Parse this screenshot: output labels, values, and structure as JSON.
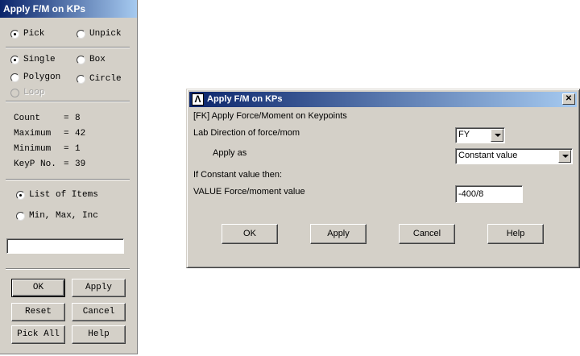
{
  "picker": {
    "title": "Apply F/M on KPs",
    "mode_options": [
      {
        "label": "Pick",
        "checked": true
      },
      {
        "label": "Unpick",
        "checked": false
      }
    ],
    "shape_options": [
      {
        "label": "Single",
        "checked": true
      },
      {
        "label": "Box",
        "checked": false
      },
      {
        "label": "Polygon",
        "checked": false
      },
      {
        "label": "Circle",
        "checked": false
      },
      {
        "label": "Loop",
        "checked": false,
        "disabled": true
      }
    ],
    "info": [
      {
        "key": "Count",
        "value": "8"
      },
      {
        "key": "Maximum",
        "value": "42"
      },
      {
        "key": "Minimum",
        "value": "1"
      },
      {
        "key": "KeyP No.",
        "value": "39"
      }
    ],
    "list_options": [
      {
        "label": "List of Items",
        "checked": true
      },
      {
        "label": "Min, Max, Inc",
        "checked": false
      }
    ],
    "entry_value": "",
    "buttons": {
      "ok": "OK",
      "apply": "Apply",
      "reset": "Reset",
      "cancel": "Cancel",
      "pick_all": "Pick All",
      "help": "Help"
    }
  },
  "dialog": {
    "title": "Apply F/M on KPs",
    "logo_glyph": "Λ",
    "close_glyph": "✕",
    "command": "[FK]  Apply Force/Moment on Keypoints",
    "lab_label": "Lab    Direction of force/mom",
    "lab_value": "FY",
    "apply_as_label": "Apply as",
    "apply_as_value": "Constant value",
    "if_constant_label": "If Constant value then:",
    "value_label": "VALUE  Force/moment value",
    "value_value": "-400/8",
    "buttons": {
      "ok": "OK",
      "apply": "Apply",
      "cancel": "Cancel",
      "help": "Help"
    }
  },
  "colors": {
    "panel_bg": "#d4d0c8",
    "titlebar_start": "#0a246a",
    "titlebar_end": "#a6caf0"
  }
}
